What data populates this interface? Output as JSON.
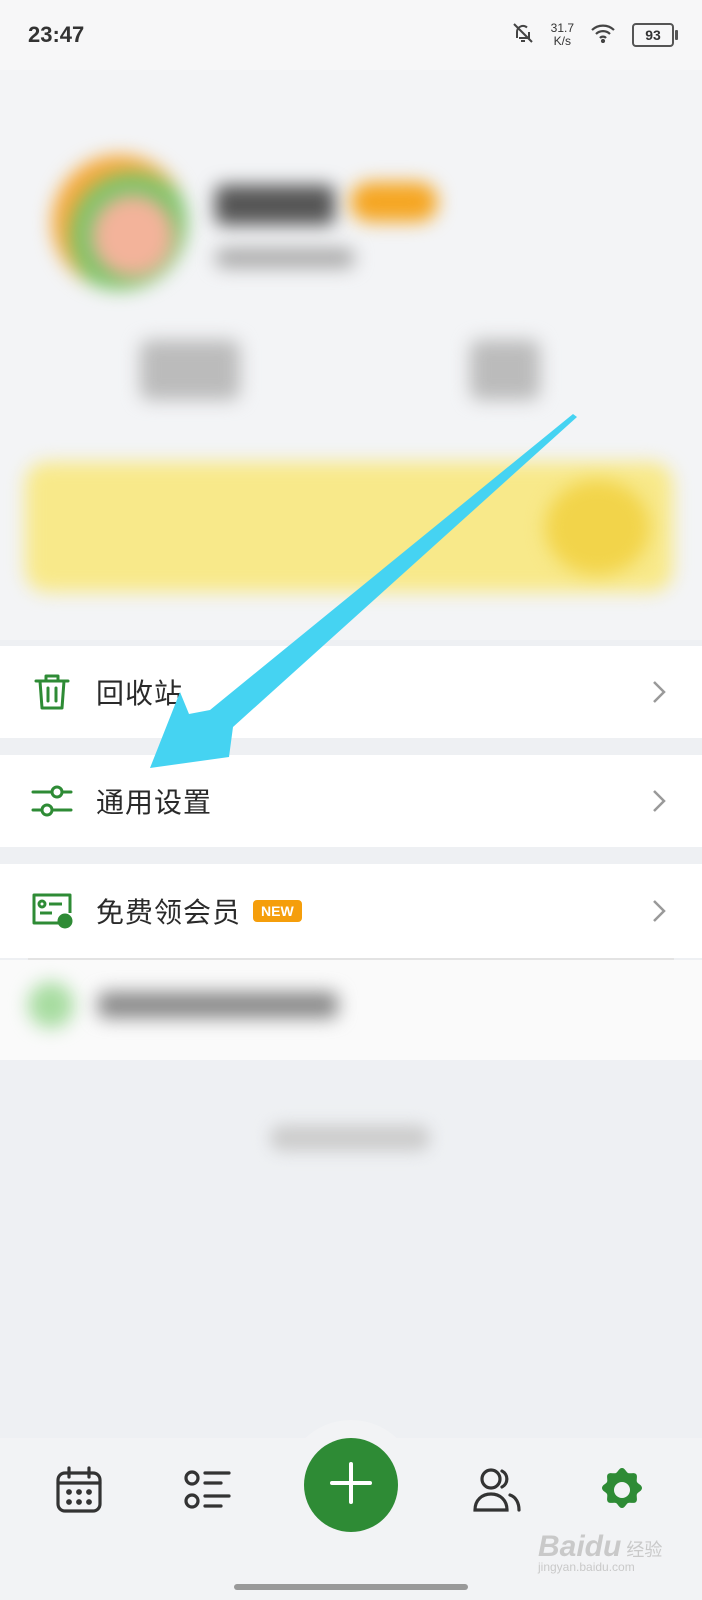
{
  "status_bar": {
    "time": "23:47",
    "net_speed_value": "31.7",
    "net_speed_unit": "K/s",
    "battery": "93"
  },
  "menu": {
    "recycle": {
      "label": "回收站"
    },
    "general_settings": {
      "label": "通用设置"
    },
    "free_vip": {
      "label": "免费领会员",
      "badge": "NEW"
    }
  },
  "colors": {
    "accent": "#2e8b35",
    "badge": "#f59e0b",
    "arrow": "#45d3f2"
  },
  "tabs": [
    "calendar-icon",
    "list-icon",
    "add-icon",
    "people-icon",
    "settings-gear-icon"
  ],
  "watermark": {
    "brand": "Baidu",
    "cn": "经验",
    "url": "jingyan.baidu.com"
  }
}
